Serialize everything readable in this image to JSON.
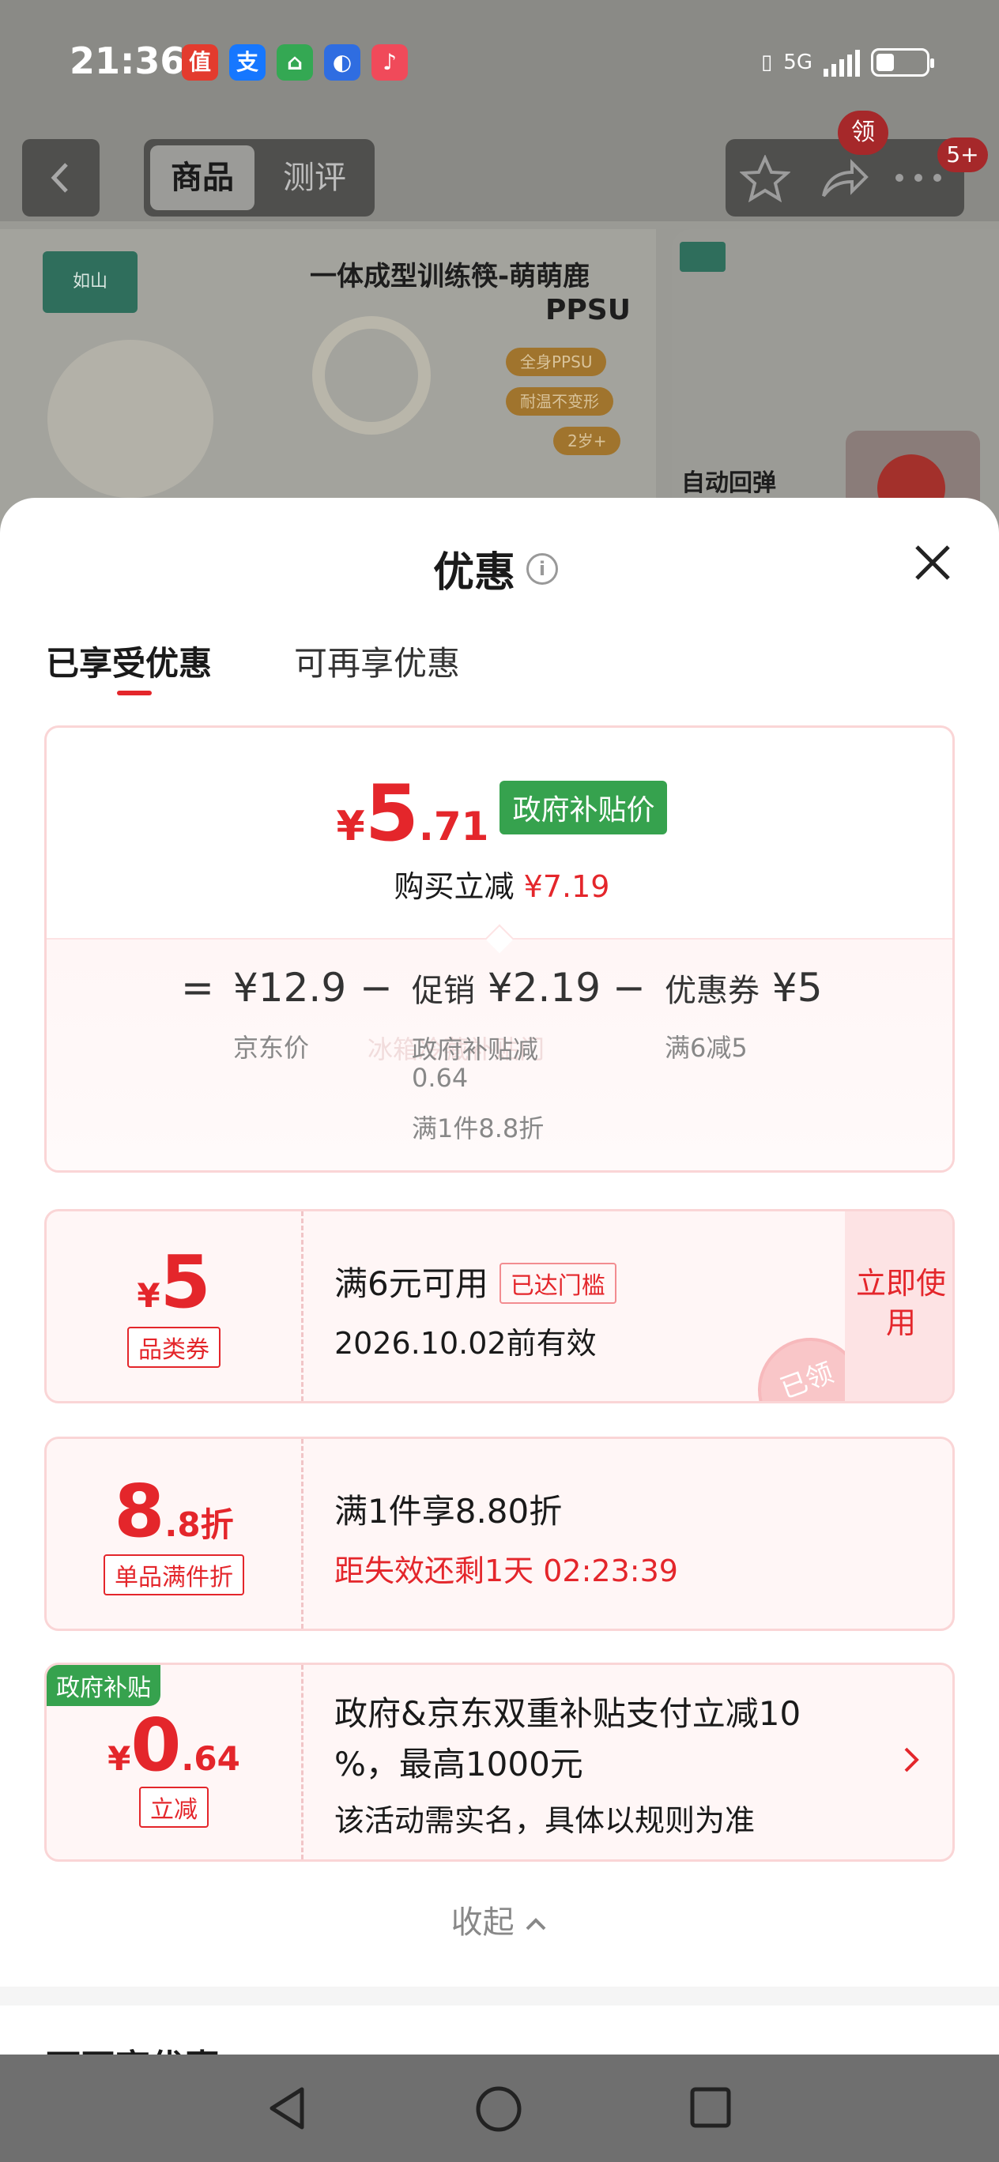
{
  "status_bar": {
    "time": "21:36",
    "apps": [
      {
        "icon": "zhidemai-icon",
        "glyph": "值",
        "color": "#e33b2e"
      },
      {
        "icon": "alipay-icon",
        "glyph": "支",
        "color": "#1677ff"
      },
      {
        "icon": "home-app-icon",
        "glyph": "⌂",
        "color": "#34a853"
      },
      {
        "icon": "compass-app-icon",
        "glyph": "◐",
        "color": "#2f6de1"
      },
      {
        "icon": "music-app-icon",
        "glyph": "♪",
        "color": "#f04a5a"
      }
    ],
    "network": "5G"
  },
  "nav": {
    "tabs": [
      "商品",
      "测评"
    ],
    "claim_badge": "领",
    "message_count": "5+"
  },
  "background_product": {
    "title_line1": "一体成型训练筷-萌萌鹿",
    "title_line2": "PPSU",
    "features": [
      "全身PPSU",
      "耐温不变形",
      "2岁+"
    ],
    "right_label": "自动回弹",
    "brand_logo": "如山"
  },
  "sheet": {
    "title": "优惠",
    "tabs": [
      "已享受优惠",
      "可再享优惠"
    ],
    "summary": {
      "final_price_yen": "¥",
      "final_price_int": "5",
      "final_price_dec": ".71",
      "price_tag": "政府补贴价",
      "discount_label": "购买立减",
      "discount_value": "¥7.19",
      "equals": "=",
      "minus": "−",
      "jd_price": "¥12.9",
      "jd_price_label": "京东价",
      "promo_label": "促销",
      "promo_value": "¥2.19",
      "promo_detail_1": "政府补贴减",
      "promo_detail_2": "0.64",
      "promo_detail_3": "满1件8.8折",
      "promo_detail_faint": "冰箱冷藏补贴门",
      "coupon_label": "优惠券",
      "coupon_value": "¥5",
      "coupon_detail": "满6减5"
    },
    "coupons": [
      {
        "amount_yen": "¥",
        "amount_int": "5",
        "kind": "品类券",
        "title": "满6元可用",
        "threshold_tag": "已达门槛",
        "subtitle": "2026.10.02前有效",
        "action": "立即使用",
        "stamp": "已领"
      },
      {
        "amount_int": "8",
        "amount_dec": ".8折",
        "kind": "单品满件折",
        "title": "满1件享8.80折",
        "subtitle": "距失效还剩1天 02:23:39"
      },
      {
        "corner_tag": "政府补贴",
        "amount_yen": "¥",
        "amount_int": "0",
        "amount_dec": ".64",
        "kind": "立减",
        "title_line1": "政府&京东双重补贴支付立减10",
        "title_line2": "%，最高1000元",
        "subtitle": "该活动需实名，具体以规则为准"
      }
    ],
    "collapse_label": "收起",
    "next_section_title": "可再享优惠"
  },
  "colors": {
    "accent_red": "#e4262b",
    "gov_green": "#36a24e",
    "card_border": "#fad5d6"
  }
}
